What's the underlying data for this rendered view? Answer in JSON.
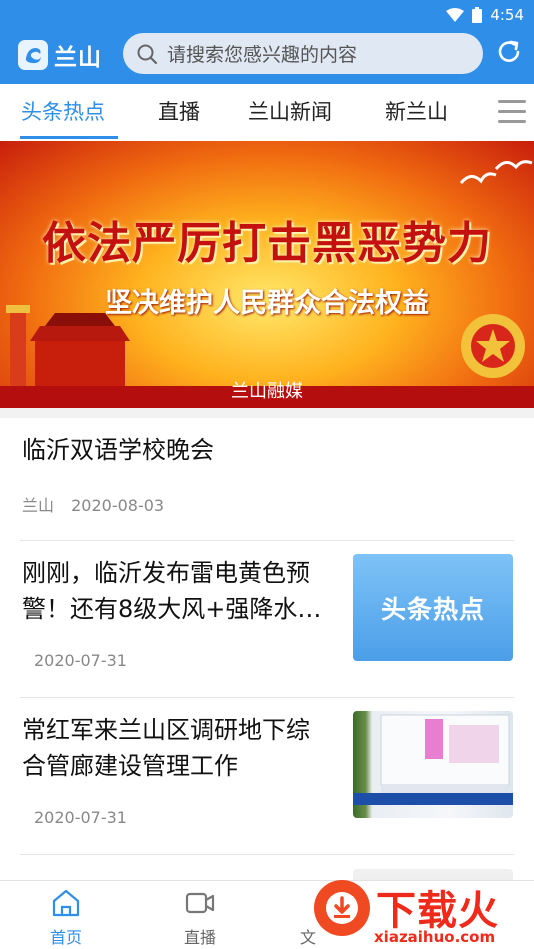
{
  "status_bar": {
    "time": "4:54",
    "wifi_icon": "wifi-icon",
    "battery_icon": "battery-icon"
  },
  "header": {
    "app_name": "兰山",
    "search_placeholder": "请搜索您感兴趣的内容",
    "refresh_icon": "refresh-icon"
  },
  "tabs": [
    {
      "label": "头条热点",
      "active": true
    },
    {
      "label": "直播",
      "active": false
    },
    {
      "label": "兰山新闻",
      "active": false
    },
    {
      "label": "新兰山",
      "active": false
    }
  ],
  "banner": {
    "headline": "依法严厉打击黑恶势力",
    "subline": "坚决维护人民群众合法权益",
    "caption": "兰山融媒"
  },
  "news": [
    {
      "title": "临沂双语学校晚会",
      "source": "兰山",
      "date": "2020-08-03"
    },
    {
      "title_line1": "刚刚，临沂发布雷电黄色预",
      "title_line2": "警！还有8级大风+强降水…",
      "date": "2020-07-31",
      "thumb_text": "头条热点"
    },
    {
      "title_line1": "常红军来兰山区调研地下综",
      "title_line2": "合管廊建设管理工作",
      "date": "2020-07-31"
    }
  ],
  "bottom_nav": [
    {
      "label": "首页",
      "active": true
    },
    {
      "label": "直播",
      "active": false
    },
    {
      "label": "文",
      "active": false
    }
  ],
  "watermark": {
    "text": "下载火",
    "url": "xiazaihuo.com"
  },
  "colors": {
    "primary": "#2f8fe8",
    "banner_red": "#c51010",
    "watermark_red": "#ef2a1a"
  }
}
